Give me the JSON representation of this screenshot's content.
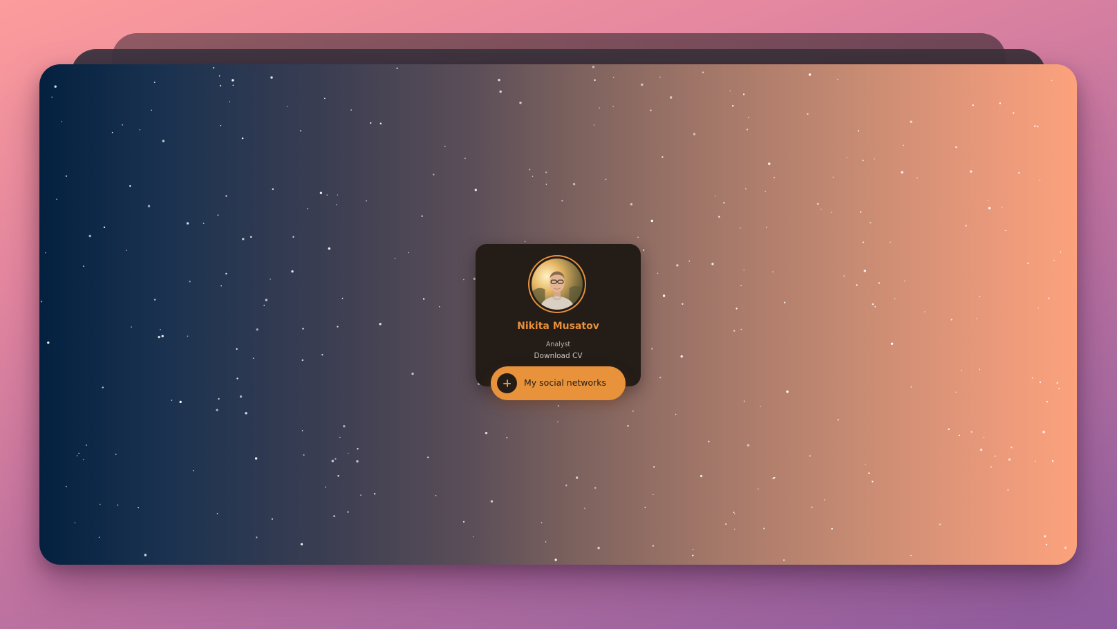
{
  "profile": {
    "name": "Nikita Musatov",
    "role": "Analyst",
    "download_label": "Download CV",
    "avatar_icon": "person-photo"
  },
  "social_button": {
    "label": "My social networks",
    "icon": "plus-icon"
  },
  "colors": {
    "accent": "#e8923c",
    "card_background": "#231c17",
    "gradient_left": "#03213f",
    "gradient_right": "#fca27c"
  }
}
